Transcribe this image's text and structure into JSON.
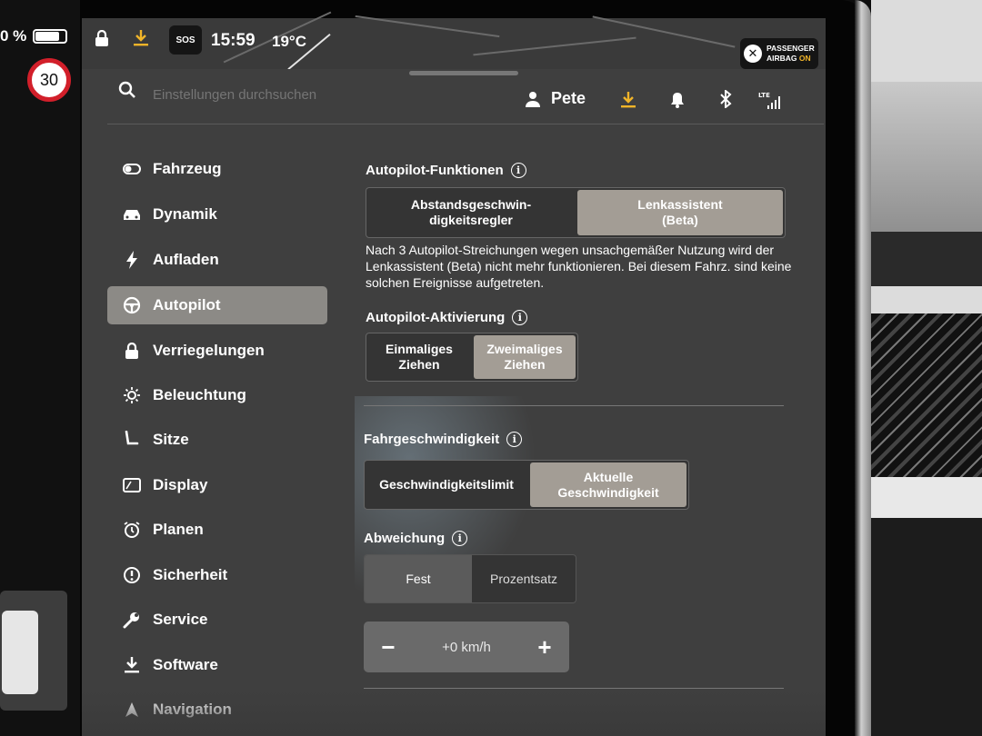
{
  "status_bar": {
    "battery_pct": "0 %",
    "speed_limit": "30",
    "sos_label": "SOS",
    "time": "15:59",
    "temperature": "19°C",
    "airbag_label": "PASSENGER",
    "airbag_label2": "AIRBAG",
    "airbag_state": "ON",
    "airbag_state_color": "#f0b429"
  },
  "header": {
    "search_placeholder": "Einstellungen durchsuchen",
    "user_name": "Pete",
    "download_color": "#f0b429",
    "network_label": "LTE"
  },
  "sidebar": {
    "items": [
      {
        "label": "Fahrzeug",
        "icon": "toggle-icon"
      },
      {
        "label": "Dynamik",
        "icon": "car-icon"
      },
      {
        "label": "Aufladen",
        "icon": "bolt-icon"
      },
      {
        "label": "Autopilot",
        "icon": "steering-wheel-icon",
        "active": true
      },
      {
        "label": "Verriegelungen",
        "icon": "lock-icon"
      },
      {
        "label": "Beleuchtung",
        "icon": "sun-icon"
      },
      {
        "label": "Sitze",
        "icon": "seat-icon"
      },
      {
        "label": "Display",
        "icon": "display-icon"
      },
      {
        "label": "Planen",
        "icon": "alarm-clock-icon"
      },
      {
        "label": "Sicherheit",
        "icon": "alert-circle-icon"
      },
      {
        "label": "Service",
        "icon": "wrench-icon"
      },
      {
        "label": "Software",
        "icon": "download-icon"
      },
      {
        "label": "Navigation",
        "icon": "navigation-arrow-icon"
      }
    ]
  },
  "autopilot_features": {
    "title": "Autopilot-Funktionen",
    "option1_line1": "Abstandsgeschwin-",
    "option1_line2": "digkeitsregler",
    "option2_line1": "Lenkassistent",
    "option2_line2": "(Beta)",
    "selected": "Lenkassistent (Beta)",
    "description": "Nach 3 Autopilot-Streichungen wegen unsachgemäßer Nutzung wird der Lenkassistent (Beta) nicht mehr funktionieren. Bei diesem Fahrz. sind keine solchen Ereignisse aufgetreten."
  },
  "autopilot_activation": {
    "title": "Autopilot-Aktivierung",
    "option1_line1": "Einmaliges",
    "option1_line2": "Ziehen",
    "option2_line1": "Zweimaliges",
    "option2_line2": "Ziehen",
    "selected": "Zweimaliges Ziehen"
  },
  "speed": {
    "title": "Fahrgeschwindigkeit",
    "option1": "Geschwindigkeitslimit",
    "option2_line1": "Aktuelle",
    "option2_line2": "Geschwindigkeit",
    "selected": "Aktuelle Geschwindigkeit"
  },
  "offset": {
    "title": "Abweichung",
    "option1": "Fest",
    "option2": "Prozentsatz",
    "selected": "Fest",
    "value": "+0 km/h",
    "minus": "−",
    "plus": "+"
  },
  "colors": {
    "panel_bg": "#3f3f3f",
    "selected_segment": "#a39d95",
    "active_nav": "#8c8a86",
    "speed_sign_ring": "#d21f2a"
  }
}
